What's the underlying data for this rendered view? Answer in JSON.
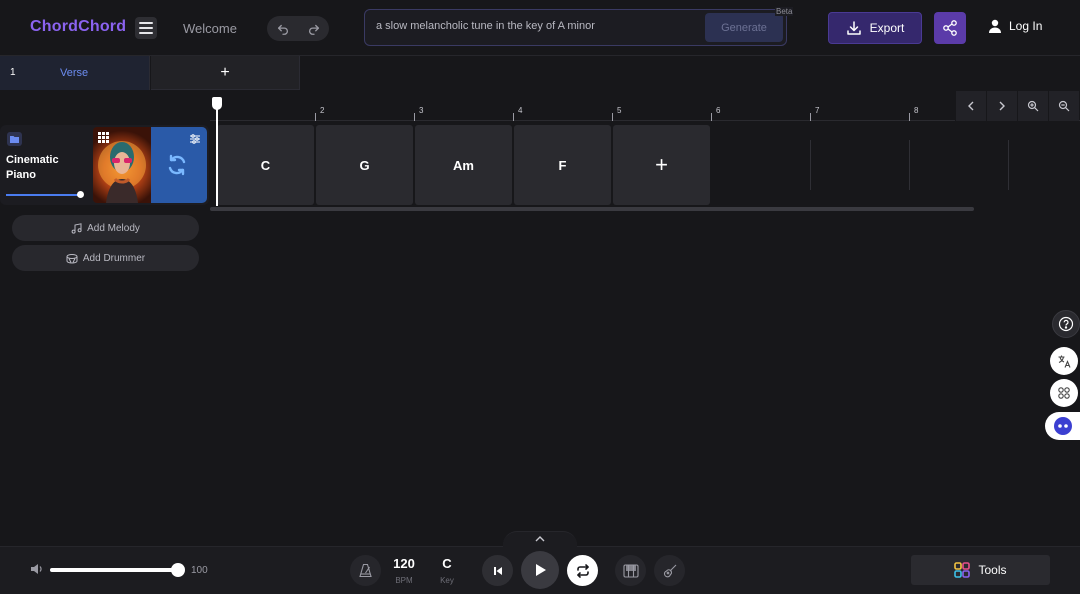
{
  "header": {
    "brand": "ChordChord",
    "welcome": "Welcome",
    "prompt_value": "a slow melancholic tune in the key of A minor",
    "generate_label": "Generate",
    "beta_label": "Beta",
    "export_label": "Export",
    "login_label": "Log In"
  },
  "sections": [
    {
      "number": "1",
      "name": "Verse"
    }
  ],
  "section_add_label": "+",
  "ruler": {
    "bar_numbers": [
      "2",
      "3",
      "4",
      "5",
      "6",
      "7",
      "8"
    ]
  },
  "track": {
    "name": "Cinematic Piano",
    "volume_fraction": 0.95
  },
  "chords": [
    "C",
    "G",
    "Am",
    "F"
  ],
  "chord_add_label": "+",
  "track_actions": {
    "add_melody": "Add Melody",
    "add_drummer": "Add Drummer"
  },
  "transport": {
    "master_volume": "100",
    "bpm_value": "120",
    "bpm_label": "BPM",
    "key_value": "C",
    "key_label": "Key",
    "tools_label": "Tools"
  },
  "colors": {
    "brand": "#8b63f0",
    "accent_blue": "#4a7cf0",
    "export_bg": "#35286d",
    "share_bg": "#5b3ba9"
  },
  "icons": [
    "menu-icon",
    "undo-icon",
    "redo-icon",
    "download-icon",
    "share-icon",
    "user-icon",
    "folder-icon",
    "grid-icon",
    "sliders-icon",
    "swap-icon",
    "music-note-icon",
    "drum-icon",
    "chevron-left-icon",
    "chevron-right-icon",
    "zoom-in-icon",
    "zoom-out-icon",
    "help-icon",
    "translate-icon",
    "apps-icon",
    "chat-bot-icon",
    "speaker-icon",
    "metronome-icon",
    "skip-back-icon",
    "play-icon",
    "loop-icon",
    "piano-icon",
    "guitar-icon",
    "tools-icon",
    "chevron-up-icon"
  ]
}
